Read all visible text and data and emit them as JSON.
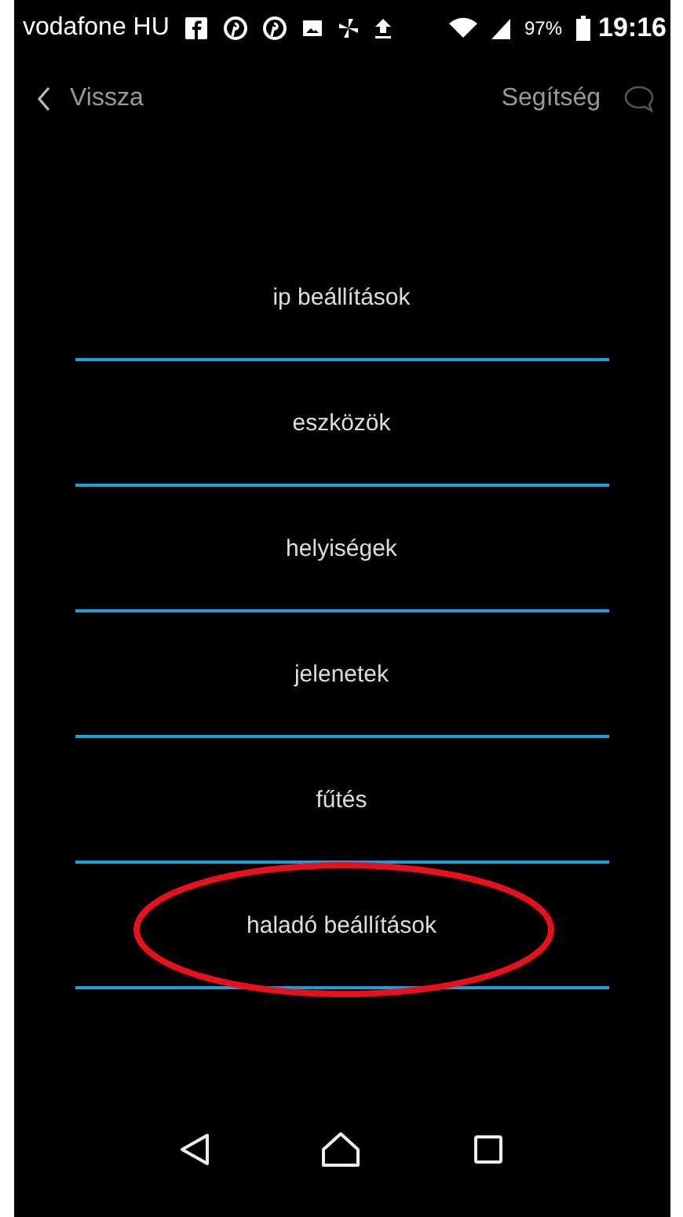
{
  "status_bar": {
    "carrier": "vodafone HU",
    "battery": "97%",
    "time": "19:16"
  },
  "header": {
    "back": "Vissza",
    "help": "Segítség"
  },
  "menu": [
    {
      "label": "ip beállítások",
      "circled": false
    },
    {
      "label": "eszközök",
      "circled": false
    },
    {
      "label": "helyiségek",
      "circled": false
    },
    {
      "label": "jelenetek",
      "circled": false
    },
    {
      "label": "fűtés",
      "circled": false
    },
    {
      "label": "haladó beállítások",
      "circled": true
    }
  ]
}
